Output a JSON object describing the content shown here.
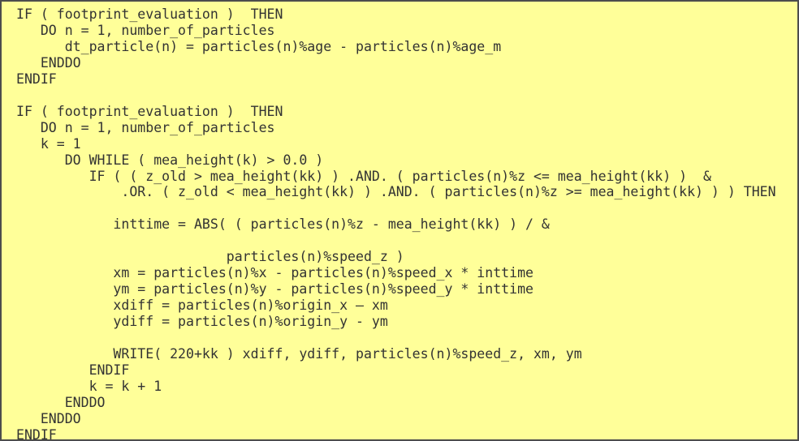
{
  "panel": {
    "kind": "code-listing",
    "language": "Fortran",
    "background_color": "#ffff99",
    "border_color": "#4d4d4d",
    "text_color": "#333333"
  },
  "code": {
    "lines": [
      "IF ( footprint_evaluation )  THEN",
      "   DO n = 1, number_of_particles",
      "      dt_particle(n) = particles(n)%age - particles(n)%age_m",
      "   ENDDO",
      "ENDIF",
      "",
      "IF ( footprint_evaluation )  THEN",
      "   DO n = 1, number_of_particles",
      "   k = 1",
      "      DO WHILE ( mea_height(k) > 0.0 )",
      "         IF ( ( z_old > mea_height(kk) ) .AND. ( particles(n)%z <= mea_height(kk) )  &",
      "             .OR. ( z_old < mea_height(kk) ) .AND. ( particles(n)%z >= mea_height(kk) ) ) THEN",
      "",
      "            inttime = ABS( ( particles(n)%z - mea_height(kk) ) / &",
      "",
      "                          particles(n)%speed_z )",
      "            xm = particles(n)%x - particles(n)%speed_x * inttime",
      "            ym = particles(n)%y - particles(n)%speed_y * inttime",
      "            xdiff = particles(n)%origin_x – xm",
      "            ydiff = particles(n)%origin_y - ym",
      "",
      "            WRITE( 220+kk ) xdiff, ydiff, particles(n)%speed_z, xm, ym",
      "         ENDIF",
      "         k = k + 1",
      "      ENDDO",
      "   ENDDO",
      "ENDIF"
    ]
  }
}
